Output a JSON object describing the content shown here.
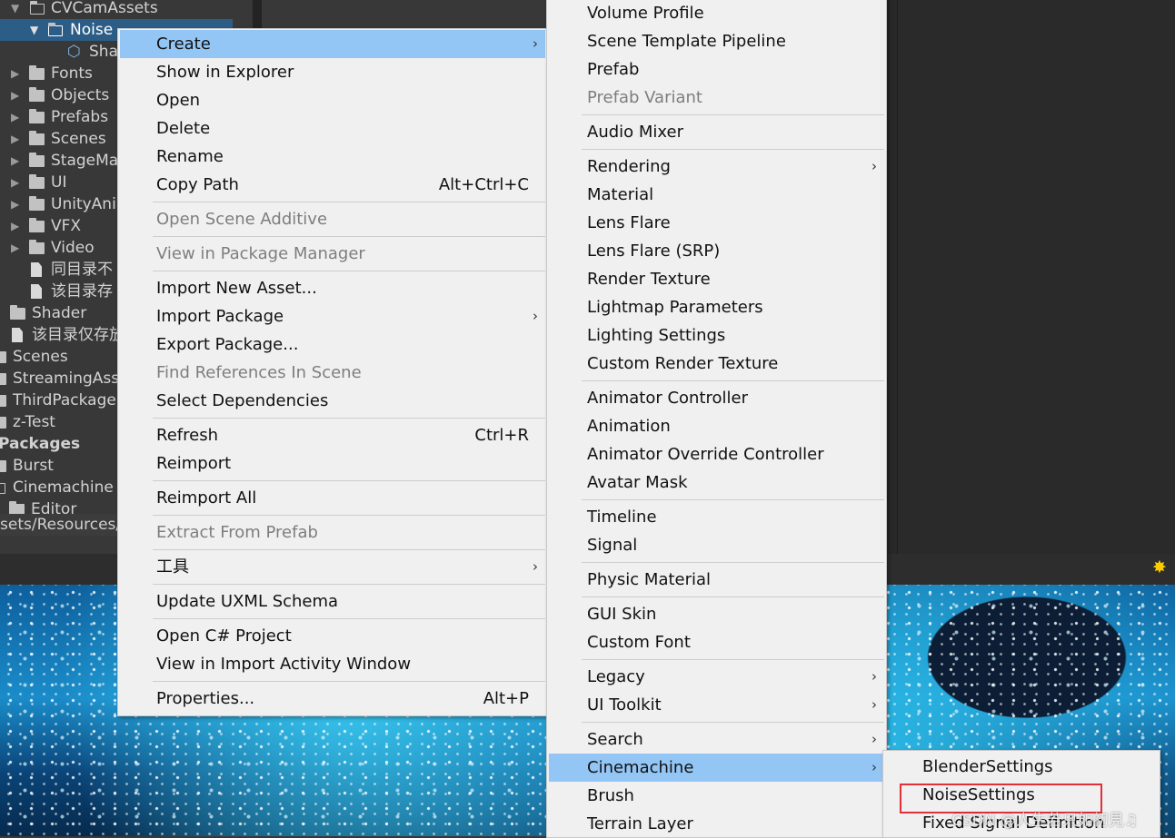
{
  "tree": {
    "rows": [
      {
        "label": "CVCamAssets",
        "icon": "folder-open-icon"
      },
      {
        "label": "Noise",
        "icon": "folder-open-icon"
      },
      {
        "label": "Sha",
        "icon": "shader-icon"
      },
      {
        "label": "Fonts",
        "icon": "folder-icon"
      },
      {
        "label": "Objects",
        "icon": "folder-icon"
      },
      {
        "label": "Prefabs",
        "icon": "folder-icon"
      },
      {
        "label": "Scenes",
        "icon": "folder-icon"
      },
      {
        "label": "StageMa",
        "icon": "folder-icon"
      },
      {
        "label": "UI",
        "icon": "folder-icon"
      },
      {
        "label": "UnityAni",
        "icon": "folder-icon"
      },
      {
        "label": "VFX",
        "icon": "folder-icon"
      },
      {
        "label": "Video",
        "icon": "folder-icon"
      },
      {
        "label": "同目录不",
        "icon": "file-icon"
      },
      {
        "label": "该目录存",
        "icon": "file-icon"
      },
      {
        "label": "Shader",
        "icon": "folder-icon"
      },
      {
        "label": "该目录仅存放",
        "icon": "file-icon"
      },
      {
        "label": "Scenes",
        "icon": "folder-icon"
      },
      {
        "label": "StreamingAss",
        "icon": "folder-icon"
      },
      {
        "label": "ThirdPackage",
        "icon": "folder-icon"
      },
      {
        "label": "z-Test",
        "icon": "folder-icon"
      },
      {
        "label": "Packages",
        "icon": ""
      },
      {
        "label": "Burst",
        "icon": "folder-icon"
      },
      {
        "label": "Cinemachine",
        "icon": "folder-icon"
      },
      {
        "label": "Editor",
        "icon": "folder-icon"
      }
    ],
    "path": "sets/Resources/"
  },
  "menu_main": {
    "items": [
      {
        "label": "Create",
        "shortcut": "",
        "submenu": true,
        "highlighted": true
      },
      {
        "label": "Show in Explorer",
        "shortcut": ""
      },
      {
        "label": "Open",
        "shortcut": ""
      },
      {
        "label": "Delete",
        "shortcut": ""
      },
      {
        "label": "Rename",
        "shortcut": ""
      },
      {
        "label": "Copy Path",
        "shortcut": "Alt+Ctrl+C"
      },
      {
        "label": "Open Scene Additive",
        "shortcut": "",
        "disabled": true
      },
      {
        "label": "View in Package Manager",
        "shortcut": "",
        "disabled": true
      },
      {
        "label": "Import New Asset...",
        "shortcut": ""
      },
      {
        "label": "Import Package",
        "shortcut": "",
        "submenu": true
      },
      {
        "label": "Export Package...",
        "shortcut": ""
      },
      {
        "label": "Find References In Scene",
        "shortcut": "",
        "disabled": true
      },
      {
        "label": "Select Dependencies",
        "shortcut": ""
      },
      {
        "label": "Refresh",
        "shortcut": "Ctrl+R"
      },
      {
        "label": "Reimport",
        "shortcut": ""
      },
      {
        "label": "Reimport All",
        "shortcut": ""
      },
      {
        "label": "Extract From Prefab",
        "shortcut": "",
        "disabled": true
      },
      {
        "label": "工具",
        "shortcut": "",
        "submenu": true
      },
      {
        "label": "Update UXML Schema",
        "shortcut": ""
      },
      {
        "label": "Open C# Project",
        "shortcut": ""
      },
      {
        "label": "View in Import Activity Window",
        "shortcut": ""
      },
      {
        "label": "Properties...",
        "shortcut": "Alt+P"
      }
    ]
  },
  "menu_create": {
    "items": [
      {
        "label": "Volume Profile"
      },
      {
        "label": "Scene Template Pipeline"
      },
      {
        "label": "Prefab"
      },
      {
        "label": "Prefab Variant",
        "disabled": true
      },
      {
        "label": "Audio Mixer"
      },
      {
        "label": "Rendering",
        "submenu": true
      },
      {
        "label": "Material"
      },
      {
        "label": "Lens Flare"
      },
      {
        "label": "Lens Flare (SRP)"
      },
      {
        "label": "Render Texture"
      },
      {
        "label": "Lightmap Parameters"
      },
      {
        "label": "Lighting Settings"
      },
      {
        "label": "Custom Render Texture"
      },
      {
        "label": "Animator Controller"
      },
      {
        "label": "Animation"
      },
      {
        "label": "Animator Override Controller"
      },
      {
        "label": "Avatar Mask"
      },
      {
        "label": "Timeline"
      },
      {
        "label": "Signal"
      },
      {
        "label": "Physic Material"
      },
      {
        "label": "GUI Skin"
      },
      {
        "label": "Custom Font"
      },
      {
        "label": "Legacy",
        "submenu": true
      },
      {
        "label": "UI Toolkit",
        "submenu": true
      },
      {
        "label": "Search",
        "submenu": true
      },
      {
        "label": "Cinemachine",
        "submenu": true,
        "highlighted": true
      },
      {
        "label": "Brush"
      },
      {
        "label": "Terrain Layer"
      }
    ]
  },
  "menu_cinemachine": {
    "items": [
      {
        "label": "BlenderSettings"
      },
      {
        "label": "NoiseSettings",
        "boxed": true
      },
      {
        "label": "Fixed Signal Definition"
      }
    ]
  },
  "watermark": "CSDN @人生若只如初見♫",
  "colors": {
    "menu_bg": "#f0f0f0",
    "highlight": "#94c6f5",
    "tree_selection": "#2c5d87",
    "annotation_box": "#e0303a"
  }
}
